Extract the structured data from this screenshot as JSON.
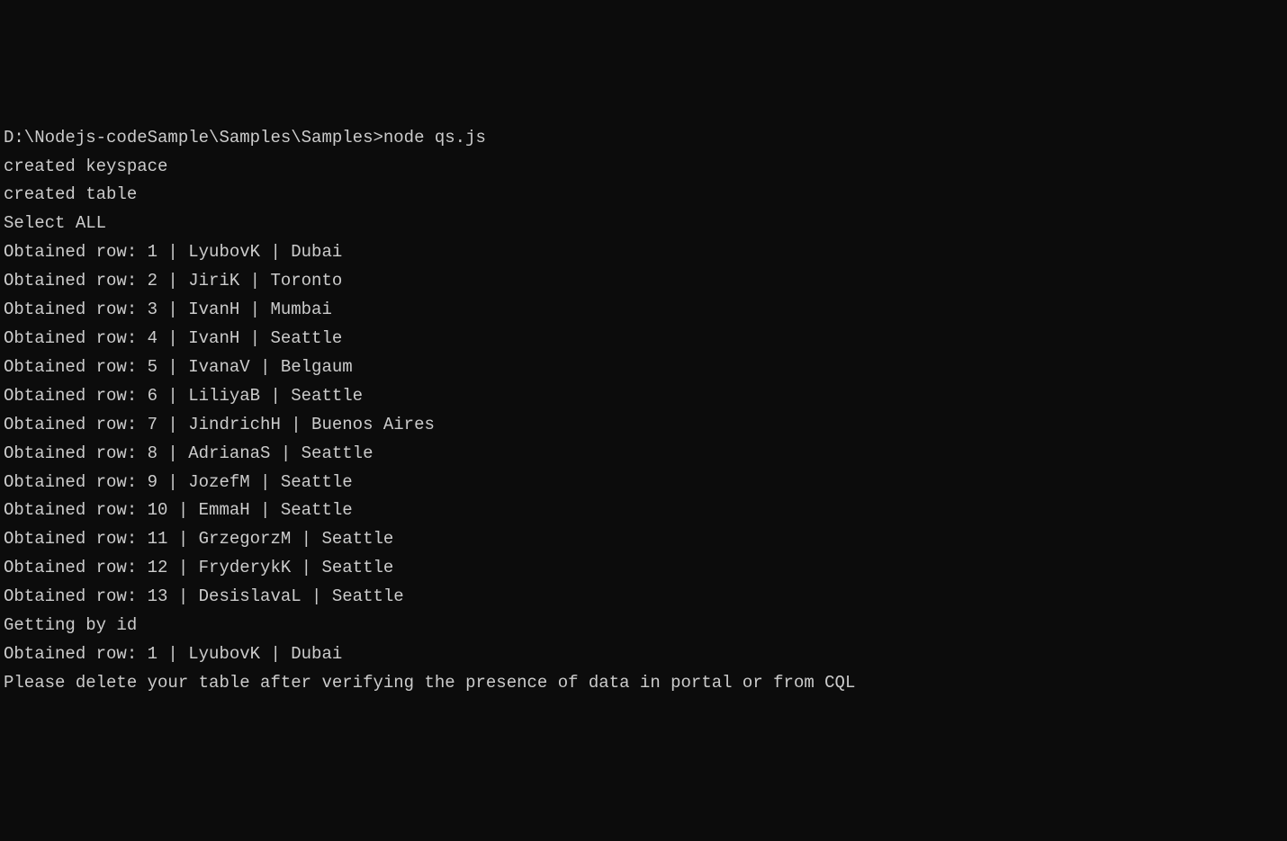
{
  "prompt": "D:\\Nodejs-codeSample\\Samples\\Samples>",
  "command": "node qs.js",
  "output_lines": [
    "created keyspace",
    "created table",
    "Select ALL"
  ],
  "rows": [
    {
      "id": 1,
      "name": "LyubovK",
      "city": "Dubai"
    },
    {
      "id": 2,
      "name": "JiriK",
      "city": "Toronto"
    },
    {
      "id": 3,
      "name": "IvanH",
      "city": "Mumbai"
    },
    {
      "id": 4,
      "name": "IvanH",
      "city": "Seattle"
    },
    {
      "id": 5,
      "name": "IvanaV",
      "city": "Belgaum"
    },
    {
      "id": 6,
      "name": "LiliyaB",
      "city": "Seattle"
    },
    {
      "id": 7,
      "name": "JindrichH",
      "city": "Buenos Aires"
    },
    {
      "id": 8,
      "name": "AdrianaS",
      "city": "Seattle"
    },
    {
      "id": 9,
      "name": "JozefM",
      "city": "Seattle"
    },
    {
      "id": 10,
      "name": "EmmaH",
      "city": "Seattle"
    },
    {
      "id": 11,
      "name": "GrzegorzM",
      "city": "Seattle"
    },
    {
      "id": 12,
      "name": "FryderykK",
      "city": "Seattle"
    },
    {
      "id": 13,
      "name": "DesislavaL",
      "city": "Seattle"
    }
  ],
  "row_prefix": "Obtained row:",
  "by_id_label": "Getting by id",
  "by_id_row": {
    "id": 1,
    "name": "LyubovK",
    "city": "Dubai"
  },
  "footer_message": "Please delete your table after verifying the presence of data in portal or from CQL"
}
